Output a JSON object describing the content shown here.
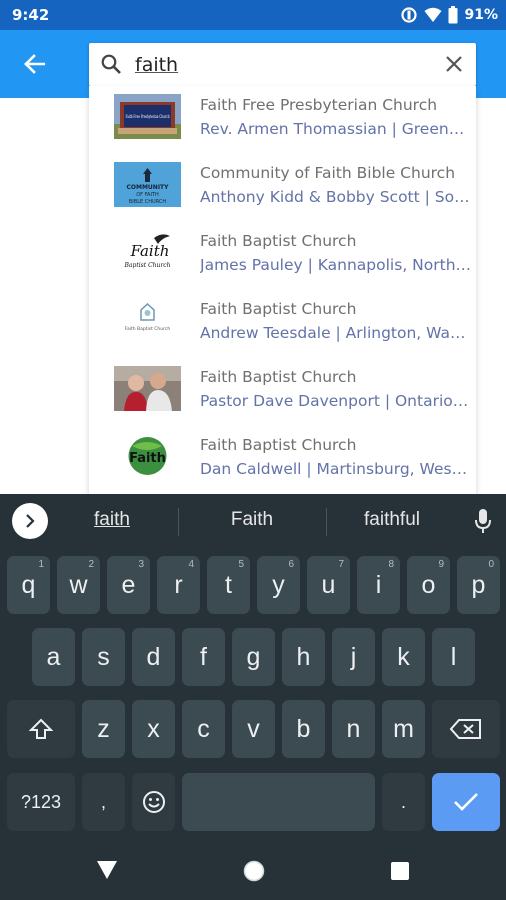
{
  "status": {
    "time": "9:42",
    "battery": "91%"
  },
  "search": {
    "query": "faith"
  },
  "results": [
    {
      "title": "Faith Free Presbyterian Church",
      "subtitle": "Rev. Armen Thomassian | Greenville, South Carolina",
      "thumb": "church-sign-photo"
    },
    {
      "title": "Community of Faith Bible Church",
      "subtitle": "Anthony Kidd & Bobby Scott | South Carolina",
      "thumb": "community-logo"
    },
    {
      "title": "Faith Baptist Church",
      "subtitle": "James Pauley | Kannapolis, North Carolina",
      "thumb": "faith-dove-logo"
    },
    {
      "title": "Faith Baptist Church",
      "subtitle": "Andrew Teesdale | Arlington, Washington",
      "thumb": "faith-baptist-logo"
    },
    {
      "title": "Faith Baptist Church",
      "subtitle": "Pastor Dave Davenport | Ontario, Oregon",
      "thumb": "pastor-photo"
    },
    {
      "title": "Faith Baptist Church",
      "subtitle": "Dan Caldwell | Martinsburg, West Virginia",
      "thumb": "faith-globe-logo"
    }
  ],
  "thumb_text": {
    "r0": "Faith Free Presbyterian Church",
    "r1_a": "COMMUNITY",
    "r1_b": "OF FAITH",
    "r1_c": "BIBLE CHURCH",
    "r2_a": "Faith",
    "r2_b": "Baptist Church",
    "r3": "Faith Baptist Church",
    "r5": "Faith"
  },
  "keyboard": {
    "suggestions": [
      "faith",
      "Faith",
      "faithful"
    ],
    "row1": [
      {
        "k": "q",
        "h": "1"
      },
      {
        "k": "w",
        "h": "2"
      },
      {
        "k": "e",
        "h": "3"
      },
      {
        "k": "r",
        "h": "4"
      },
      {
        "k": "t",
        "h": "5"
      },
      {
        "k": "y",
        "h": "6"
      },
      {
        "k": "u",
        "h": "7"
      },
      {
        "k": "i",
        "h": "8"
      },
      {
        "k": "o",
        "h": "9"
      },
      {
        "k": "p",
        "h": "0"
      }
    ],
    "row2": [
      "a",
      "s",
      "d",
      "f",
      "g",
      "h",
      "j",
      "k",
      "l"
    ],
    "row3": [
      "z",
      "x",
      "c",
      "v",
      "b",
      "n",
      "m"
    ],
    "symbols_label": "?123",
    "comma": ",",
    "period": "."
  },
  "colors": {
    "app_bar": "#2196f3",
    "status_bar": "#1565c0",
    "keyboard_bg": "#263238",
    "key": "#3c4a51",
    "enter": "#5b9bf3",
    "subtitle": "#6373a8"
  }
}
